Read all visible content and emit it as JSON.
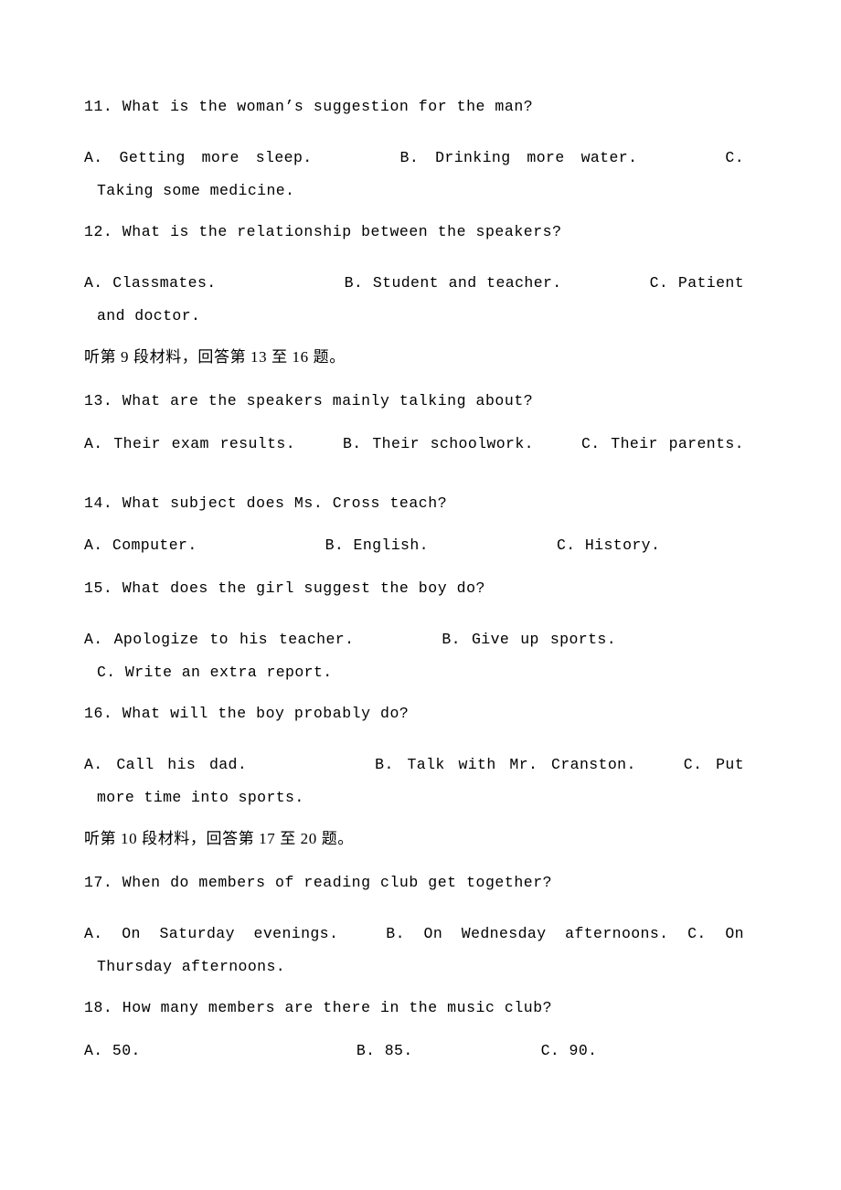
{
  "document": {
    "type": "english-listening-exam-paper",
    "language_mix": "english-chinese",
    "page_background": "#ffffff",
    "text_color": "#000000"
  },
  "questions": [
    {
      "number": "11.",
      "stem": "11. What is the woman’s suggestion for the man?",
      "options": [
        {
          "letter": "A.",
          "text": "A. Getting more sleep."
        },
        {
          "letter": "B.",
          "text": "B. Drinking more water."
        },
        {
          "letter": "C.",
          "text": "C.  Taking  some  medicine."
        }
      ],
      "options_line": "A. Getting more sleep.        B. Drinking more water.        C.  Taking  some medicine."
    },
    {
      "number": "12.",
      "stem": "12. What is the relationship between the speakers?",
      "options": [
        {
          "letter": "A.",
          "text": "A. Classmates."
        },
        {
          "letter": "B.",
          "text": "B. Student and teacher."
        },
        {
          "letter": "C.",
          "text": "C. Patient and doctor."
        }
      ]
    },
    {
      "number": "13.",
      "stem": "13. What are the speakers mainly talking about?",
      "options": [
        {
          "letter": "A.",
          "text": "A. Their exam results."
        },
        {
          "letter": "B.",
          "text": "B. Their schoolwork."
        },
        {
          "letter": "C.",
          "text": "C. Their parents."
        }
      ]
    },
    {
      "number": "14.",
      "stem": "14. What subject does Ms. Cross teach?",
      "options": [
        {
          "letter": "A.",
          "text": "A. Computer."
        },
        {
          "letter": "B.",
          "text": "B. English."
        },
        {
          "letter": "C.",
          "text": "C. History."
        }
      ]
    },
    {
      "number": "15.",
      "stem": "15. What does the girl suggest the boy do?",
      "options": [
        {
          "letter": "A.",
          "text": "A. Apologize to his teacher."
        },
        {
          "letter": "B.",
          "text": "B. Give up sports."
        },
        {
          "letter": "C.",
          "text": "C. Write an extra report."
        }
      ]
    },
    {
      "number": "16.",
      "stem": "16. What will the boy probably do?",
      "options": [
        {
          "letter": "A.",
          "text": "A. Call his dad."
        },
        {
          "letter": "B.",
          "text": "B. Talk with Mr. Cranston."
        },
        {
          "letter": "C.",
          "text": "C.  Put  more  time into sports."
        }
      ]
    },
    {
      "number": "17.",
      "stem": "17. When do members of reading club get together?",
      "options": [
        {
          "letter": "A.",
          "text": "A. On Saturday evenings."
        },
        {
          "letter": "B.",
          "text": "B. On Wednesday afternoons."
        },
        {
          "letter": "C.",
          "text": "C.  On  Thursday afternoons."
        }
      ]
    },
    {
      "number": "18.",
      "stem": "18. How many members are there in the music club?",
      "options": [
        {
          "letter": "A.",
          "text": "A. 50."
        },
        {
          "letter": "B.",
          "text": "B. 85."
        },
        {
          "letter": "C.",
          "text": "C. 90."
        }
      ]
    }
  ],
  "section_headers": [
    {
      "id": "section-9",
      "text": "听第 9 段材料，回答第 13 至 16 题。",
      "passage_number": "9",
      "question_range": "13 至 16"
    },
    {
      "id": "section-10",
      "text": "听第 10 段材料，回答第 17 至 20 题。",
      "passage_number": "10",
      "question_range": "17 至 20"
    }
  ],
  "lines": {
    "q11_stem": "11. What is the woman’s suggestion for the man?",
    "q11_a": "A. Getting more sleep.",
    "q11_b": "B. Drinking more water.",
    "q11_c": "C.  Taking  some",
    "q11_c_wrap": "medicine.",
    "q12_stem": "12. What is the relationship between the speakers?",
    "q12_a": "A. Classmates.",
    "q12_b": "B. Student and teacher.",
    "q12_c": "C.",
    "q12_c_wrap": "Patient and doctor.",
    "cn_9": "听第 9 段材料，回答第 13 至 16 题。",
    "q13_stem": "13. What are the speakers mainly talking about?",
    "q13_a": "A. Their exam results.",
    "q13_b": "B. Their schoolwork.",
    "q13_c": "C. Their parents.",
    "q14_stem": "14. What subject does Ms. Cross teach?",
    "q14_a": "A. Computer.",
    "q14_b": "B. English.",
    "q14_c": "C. History.",
    "q15_stem": "15. What does the girl suggest the boy do?",
    "q15_a": "A. Apologize to his teacher.",
    "q15_b": "B. Give up sports.",
    "q15_c": "C.",
    "q15_c_wrap": "Write an extra report.",
    "q16_stem": "16. What will the boy probably do?",
    "q16_a": "A. Call his dad.",
    "q16_b": "B. Talk with Mr. Cranston.",
    "q16_c": "C.  Put  more",
    "q16_c_wrap": "time into sports.",
    "cn_10": "听第 10 段材料，回答第 17 至 20 题。",
    "q17_stem": "17. When do members of reading club get together?",
    "q17_a": "A. On Saturday evenings.",
    "q17_b": "B. On Wednesday afternoons.",
    "q17_c": "C.    On    Thursday",
    "q17_c_wrap": "afternoons.",
    "q18_stem": "18. How many members are there in the music club?",
    "q18_a": "A. 50.",
    "q18_b": "B. 85.",
    "q18_c": "C. 90."
  }
}
